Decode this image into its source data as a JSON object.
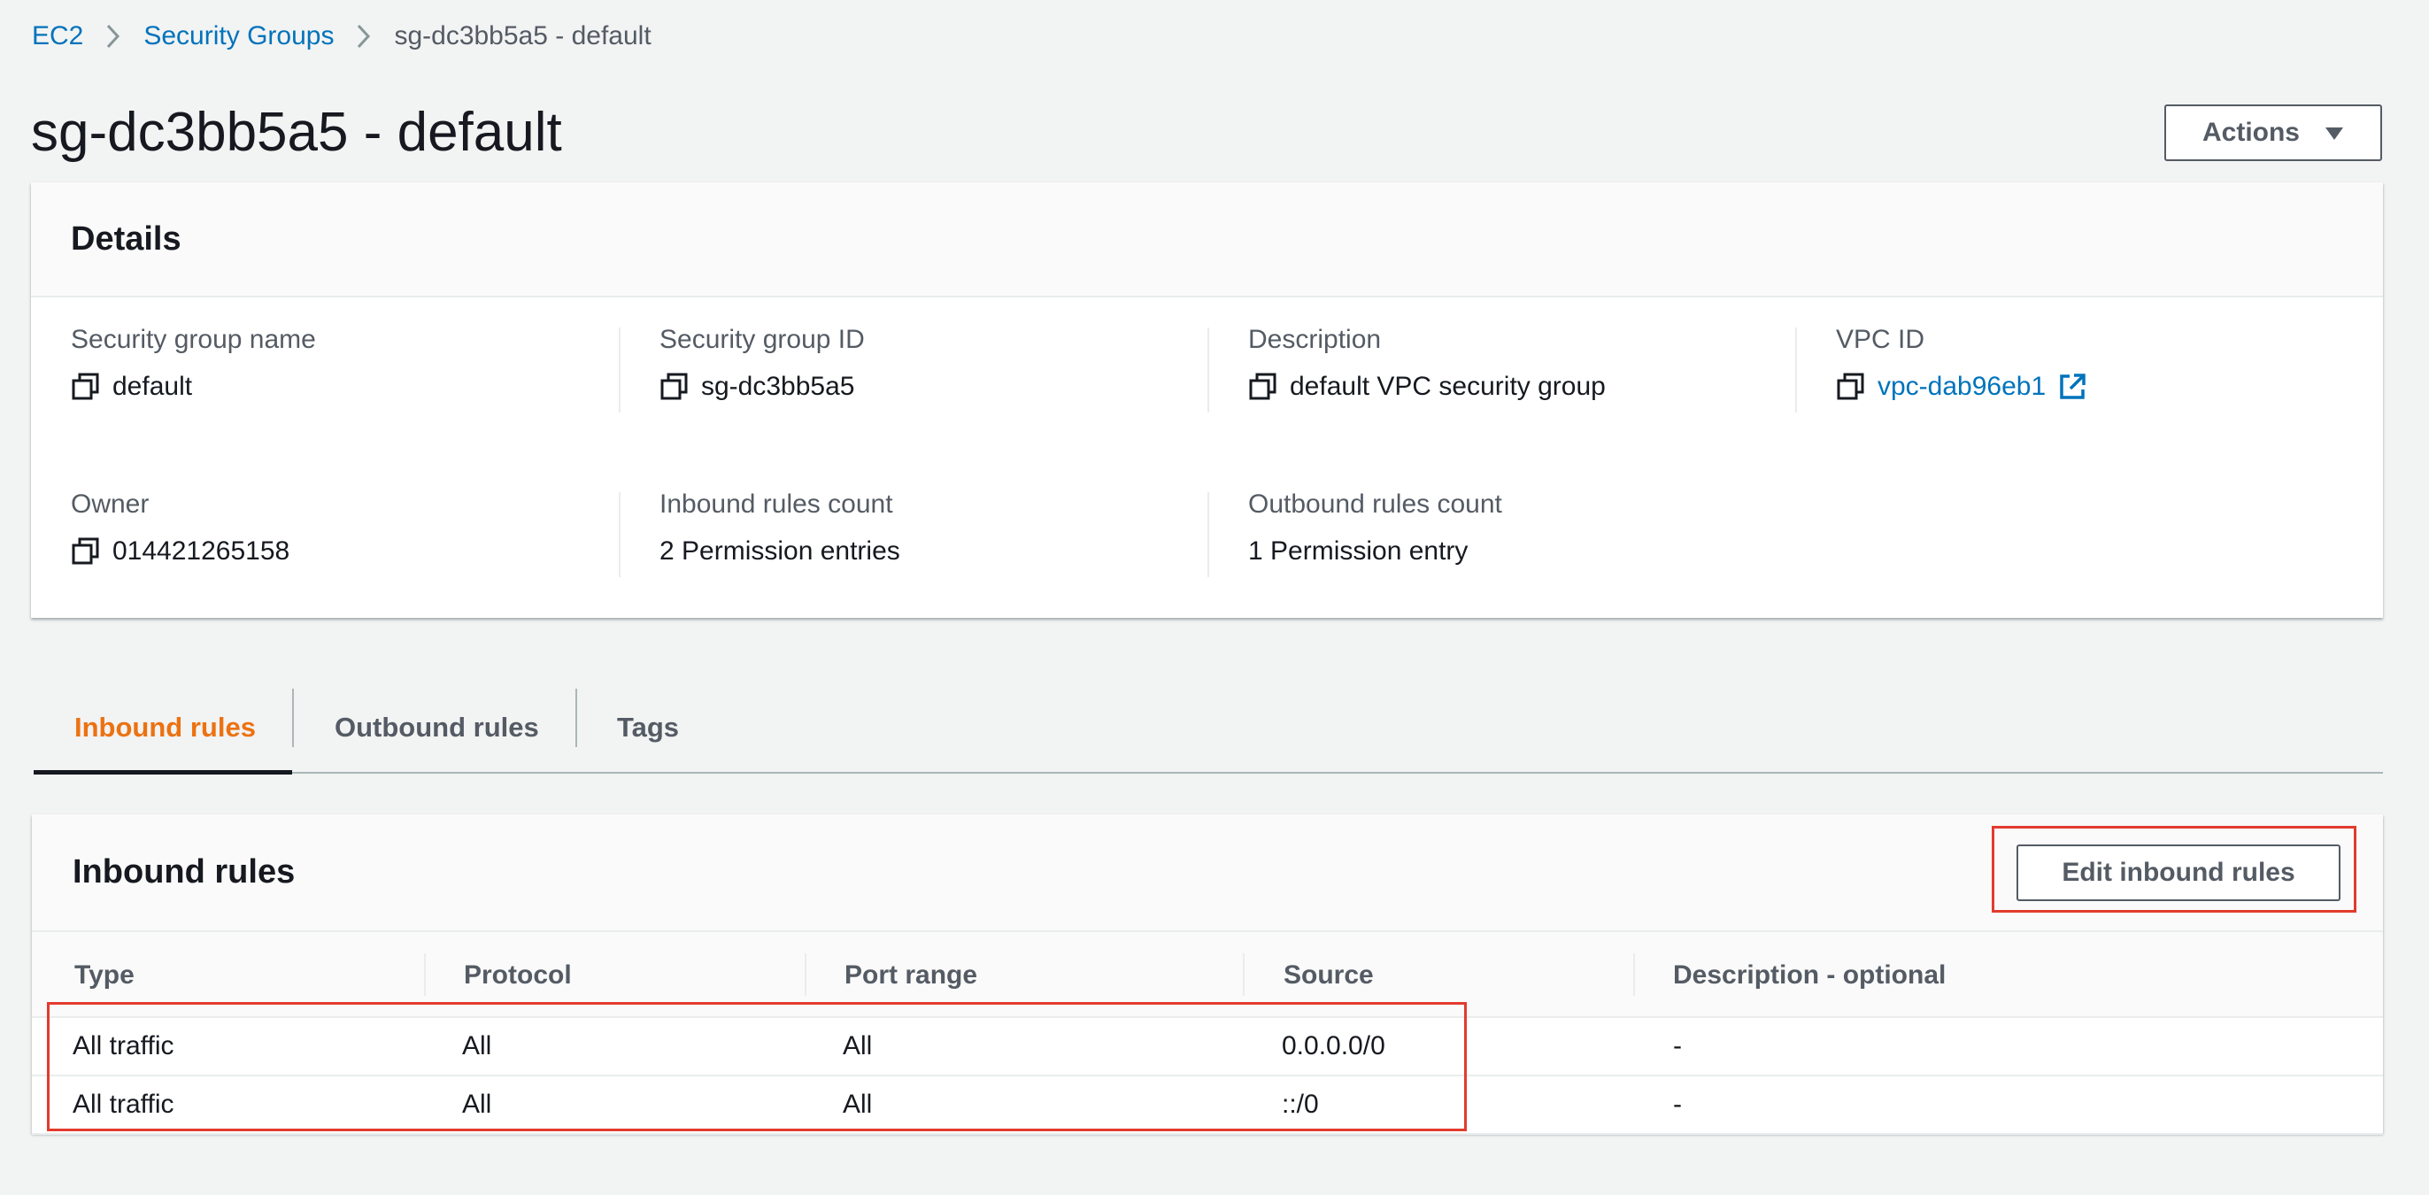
{
  "breadcrumb": {
    "items": [
      "EC2",
      "Security Groups"
    ],
    "current": "sg-dc3bb5a5 - default"
  },
  "page": {
    "title": "sg-dc3bb5a5 - default",
    "actions_label": "Actions"
  },
  "details": {
    "title": "Details",
    "fields": {
      "sg_name": {
        "label": "Security group name",
        "value": "default"
      },
      "sg_id": {
        "label": "Security group ID",
        "value": "sg-dc3bb5a5"
      },
      "description": {
        "label": "Description",
        "value": "default VPC security group"
      },
      "vpc_id": {
        "label": "VPC ID",
        "value": "vpc-dab96eb1"
      },
      "owner": {
        "label": "Owner",
        "value": "014421265158"
      },
      "inbound_count": {
        "label": "Inbound rules count",
        "value": "2 Permission entries"
      },
      "outbound_count": {
        "label": "Outbound rules count",
        "value": "1 Permission entry"
      }
    }
  },
  "tabs": [
    {
      "label": "Inbound rules",
      "active": true
    },
    {
      "label": "Outbound rules",
      "active": false
    },
    {
      "label": "Tags",
      "active": false
    }
  ],
  "inbound": {
    "title": "Inbound rules",
    "edit_label": "Edit inbound rules",
    "columns": [
      "Type",
      "Protocol",
      "Port range",
      "Source",
      "Description - optional"
    ],
    "rows": [
      [
        "All traffic",
        "All",
        "All",
        "0.0.0.0/0",
        "-"
      ],
      [
        "All traffic",
        "All",
        "All",
        "::/0",
        "-"
      ]
    ]
  },
  "colors": {
    "link": "#0073bb",
    "active_tab": "#ec7211",
    "highlight": "#e23b2e",
    "background": "#f2f3f3"
  }
}
